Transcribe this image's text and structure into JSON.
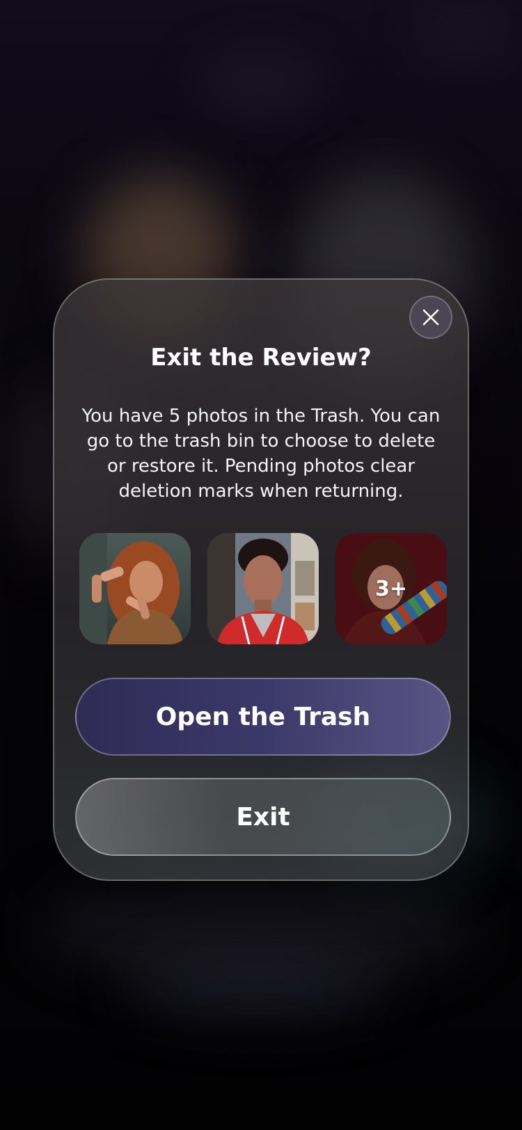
{
  "dialog": {
    "title": "Exit the Review?",
    "message": "You have 5 photos in the Trash. You can go to the trash bin to choose to delete or restore it. Pending photos clear deletion marks when returning.",
    "close_icon": "close-icon",
    "thumbnails": [
      {
        "name": "woman-framing-photo"
      },
      {
        "name": "man-red-jacket-photo"
      },
      {
        "name": "woman-striped-sleeves-photo",
        "overlay": "3+"
      }
    ],
    "primary_button": "Open the Trash",
    "secondary_button": "Exit"
  },
  "colors": {
    "primary_button_start": "#2f2b55",
    "primary_button_end": "#5a5485",
    "text": "#ffffff"
  }
}
